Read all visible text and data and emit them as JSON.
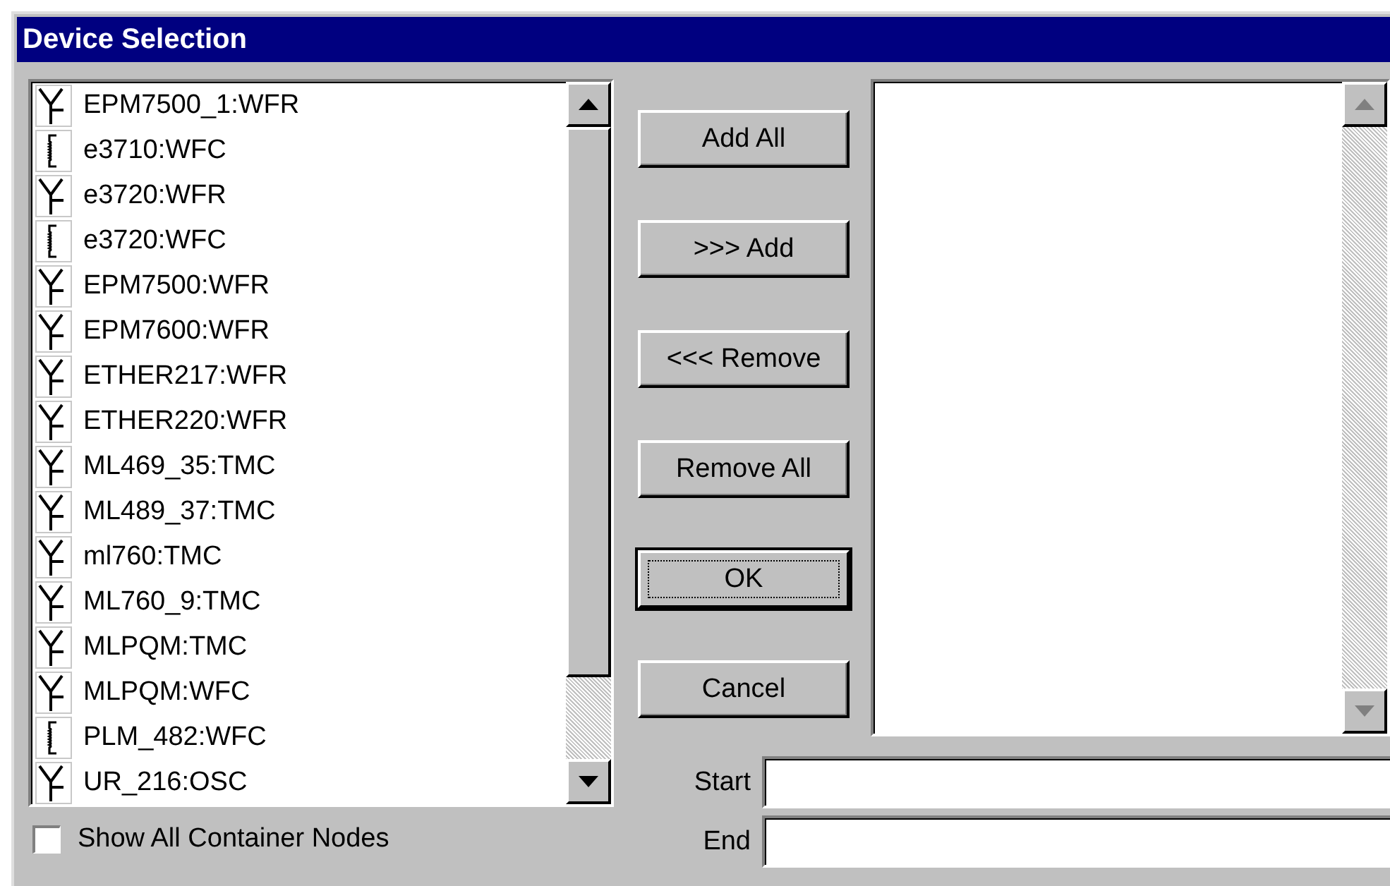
{
  "window": {
    "title": "Device Selection"
  },
  "available_list": {
    "items": [
      {
        "label": "EPM7500_1:WFR",
        "kind": "antenna"
      },
      {
        "label": "e3710:WFC",
        "kind": "coil"
      },
      {
        "label": "e3720:WFR",
        "kind": "antenna"
      },
      {
        "label": "e3720:WFC",
        "kind": "coil"
      },
      {
        "label": "EPM7500:WFR",
        "kind": "antenna"
      },
      {
        "label": "EPM7600:WFR",
        "kind": "antenna"
      },
      {
        "label": "ETHER217:WFR",
        "kind": "antenna"
      },
      {
        "label": "ETHER220:WFR",
        "kind": "antenna"
      },
      {
        "label": "ML469_35:TMC",
        "kind": "antenna"
      },
      {
        "label": "ML489_37:TMC",
        "kind": "antenna"
      },
      {
        "label": "ml760:TMC",
        "kind": "antenna"
      },
      {
        "label": "ML760_9:TMC",
        "kind": "antenna"
      },
      {
        "label": "MLPQM:TMC",
        "kind": "antenna"
      },
      {
        "label": "MLPQM:WFC",
        "kind": "antenna"
      },
      {
        "label": "PLM_482:WFC",
        "kind": "coil"
      },
      {
        "label": "UR_216:OSC",
        "kind": "antenna"
      }
    ]
  },
  "show_all_container_nodes": {
    "label": "Show All Container Nodes",
    "checked": false
  },
  "buttons": [
    {
      "label": "Add All",
      "default": false
    },
    {
      "label": ">>> Add",
      "default": false
    },
    {
      "label": "<<< Remove",
      "default": false
    },
    {
      "label": "Remove All",
      "default": false
    },
    {
      "label": "OK",
      "default": true
    },
    {
      "label": "Cancel",
      "default": false
    }
  ],
  "fields": [
    {
      "label": "Start"
    },
    {
      "label": "End"
    }
  ]
}
